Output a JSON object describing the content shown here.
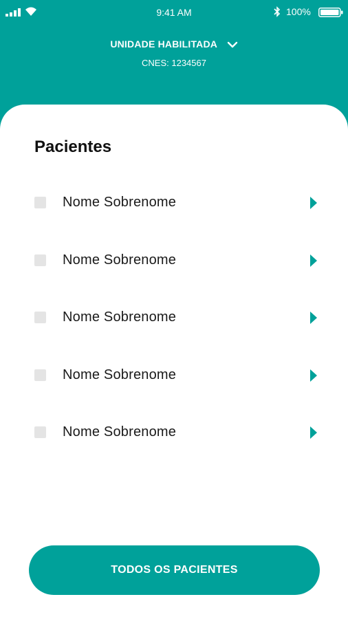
{
  "status_bar": {
    "time": "9:41 AM",
    "battery_percent": "100%",
    "icons": [
      "signal-icon",
      "wifi-icon",
      "bluetooth-icon",
      "battery-icon"
    ]
  },
  "header": {
    "unit_label": "UNIDADE HABILITADA",
    "cnes": "CNES: 1234567"
  },
  "patients": {
    "title": "Pacientes",
    "items": [
      {
        "name": "Nome Sobrenome",
        "checked": false
      },
      {
        "name": "Nome Sobrenome",
        "checked": false
      },
      {
        "name": "Nome Sobrenome",
        "checked": false
      },
      {
        "name": "Nome Sobrenome",
        "checked": false
      },
      {
        "name": "Nome Sobrenome",
        "checked": false
      }
    ]
  },
  "footer": {
    "all_patients_label": "TODOS OS PACIENTES"
  },
  "colors": {
    "brand": "#00a19a",
    "card": "#ffffff",
    "checkbox": "#e4e4e4",
    "text": "#1a1a1a"
  }
}
